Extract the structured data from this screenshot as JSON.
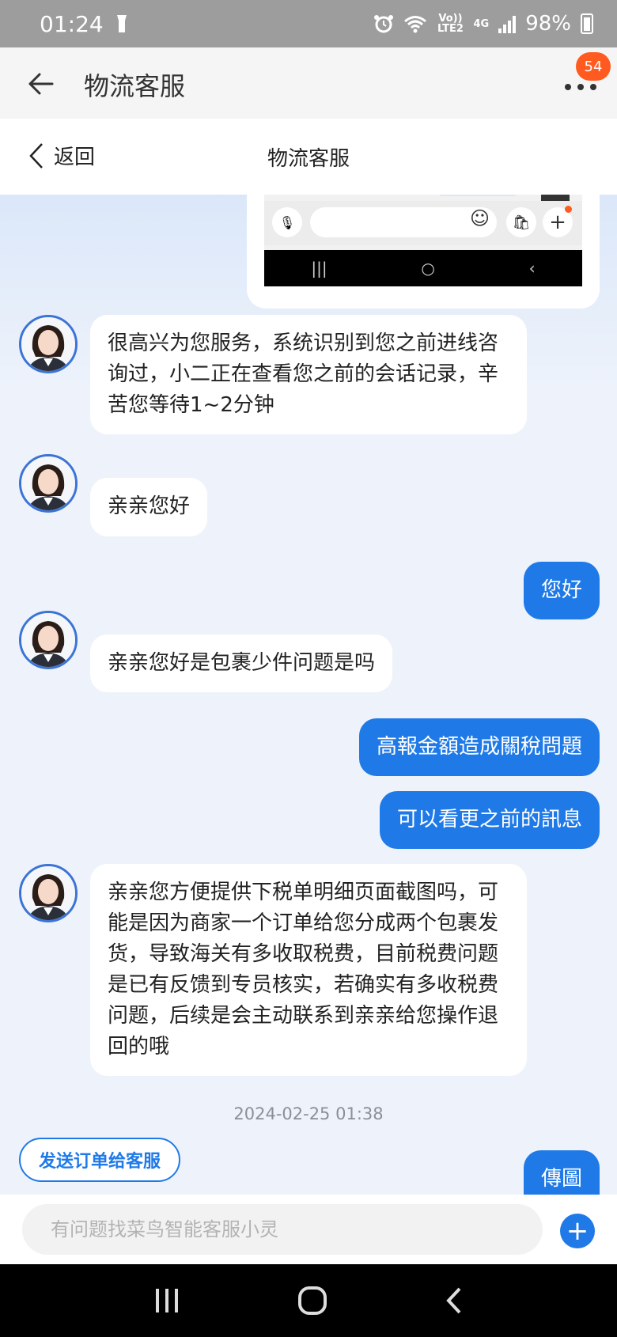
{
  "status_bar": {
    "time": "01:24",
    "volte_label": "Vo)) LTE2",
    "network": "4G",
    "battery": "98%"
  },
  "header": {
    "title": "物流客服",
    "badge_count": "54"
  },
  "sub_header": {
    "back_label": "返回",
    "title": "物流客服"
  },
  "messages": [
    {
      "side": "left",
      "text": "很高兴为您服务，系统识别到您之前进线咨询过，小二正在查看您之前的会话记录，辛苦您等待1~2分钟"
    },
    {
      "side": "left",
      "text": "亲亲您好"
    },
    {
      "side": "right",
      "text": "您好"
    },
    {
      "side": "left",
      "text": "亲亲您好是包裹少件问题是吗"
    },
    {
      "side": "right",
      "text": "高報金額造成關稅問題"
    },
    {
      "side": "right",
      "text": "可以看更之前的訊息"
    },
    {
      "side": "left",
      "text": "亲亲您方便提供下税单明细页面截图吗，可能是因为商家一个订单给您分成两个包裹发货，导致海关有多收取税费，目前税费问题是已有反馈到专员核实，若确实有多收税费问题，后续是会主动联系到亲亲给您操作退回的哦"
    },
    {
      "side": "right",
      "text": "傳圖"
    }
  ],
  "timestamp": "2024-02-25 01:38",
  "send_order_label": "发送订单给客服",
  "input": {
    "placeholder": "有问题找菜鸟智能客服小灵"
  },
  "colors": {
    "accent": "#1f7ae8",
    "badge": "#ff5a1f",
    "chat_bg": "#eef3fb"
  }
}
